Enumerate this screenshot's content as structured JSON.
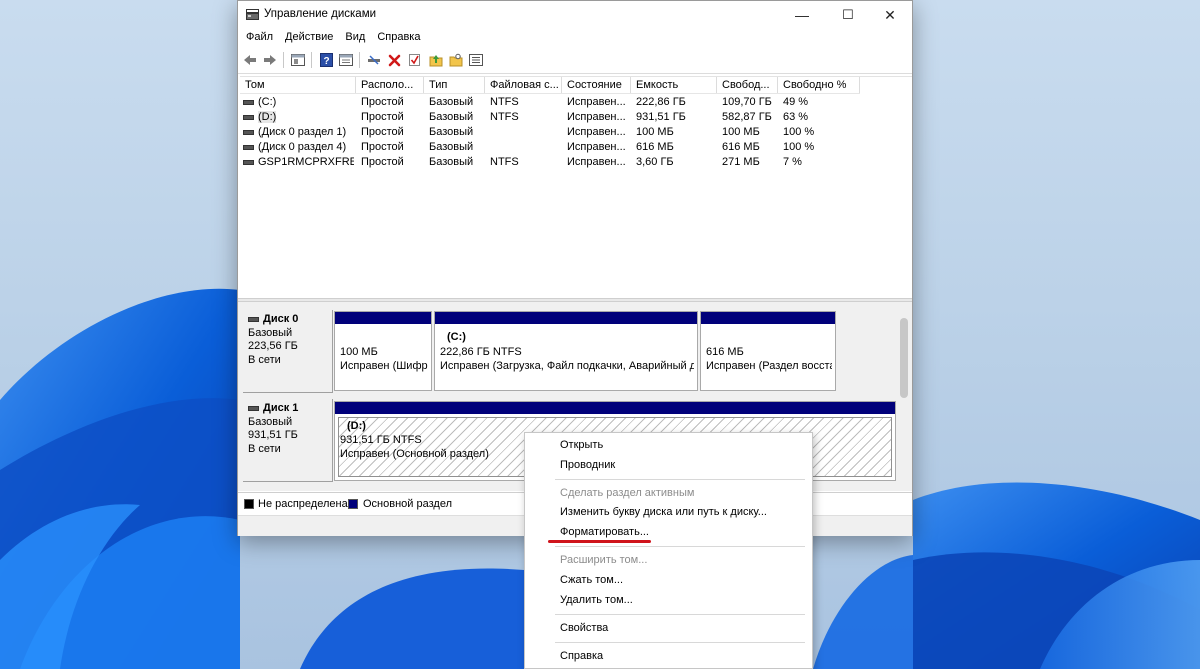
{
  "window": {
    "title": "Управление дисками",
    "minimize_glyph": "—",
    "maximize_glyph": "☐",
    "close_glyph": "✕"
  },
  "menu": [
    "Файл",
    "Действие",
    "Вид",
    "Справка"
  ],
  "toolbar": {
    "icons": [
      "back-icon",
      "forward-icon",
      "properties-pane-icon",
      "help-icon",
      "console-icon",
      "connect-icon",
      "delete-icon",
      "check-icon",
      "folder-up-icon",
      "folder-search-icon",
      "details-icon"
    ]
  },
  "volume_table": {
    "columns": [
      "Том",
      "Располо...",
      "Тип",
      "Файловая с...",
      "Состояние",
      "Емкость",
      "Свобод...",
      "Свободно %"
    ],
    "rows": [
      {
        "name": "(C:)",
        "layout": "Простой",
        "type": "Базовый",
        "fs": "NTFS",
        "status": "Исправен...",
        "capacity": "222,86 ГБ",
        "free": "109,70 ГБ",
        "free_pct": "49 %"
      },
      {
        "name": "(D:)",
        "layout": "Простой",
        "type": "Базовый",
        "fs": "NTFS",
        "status": "Исправен...",
        "capacity": "931,51 ГБ",
        "free": "582,87 ГБ",
        "free_pct": "63 %"
      },
      {
        "name": "(Диск 0 раздел 1)",
        "layout": "Простой",
        "type": "Базовый",
        "fs": "",
        "status": "Исправен...",
        "capacity": "100 МБ",
        "free": "100 МБ",
        "free_pct": "100 %"
      },
      {
        "name": "(Диск 0 раздел 4)",
        "layout": "Простой",
        "type": "Базовый",
        "fs": "",
        "status": "Исправен...",
        "capacity": "616 МБ",
        "free": "616 МБ",
        "free_pct": "100 %"
      },
      {
        "name": "GSP1RMCPRXFRE...",
        "layout": "Простой",
        "type": "Базовый",
        "fs": "NTFS",
        "status": "Исправен...",
        "capacity": "3,60 ГБ",
        "free": "271 МБ",
        "free_pct": "7 %"
      }
    ]
  },
  "disks": [
    {
      "label": "Диск 0",
      "type": "Базовый",
      "size": "223,56 ГБ",
      "state": "В сети",
      "partitions": [
        {
          "title": "",
          "line1": "100 МБ",
          "line2": "Исправен (Шифр"
        },
        {
          "title": "(C:)",
          "line1": "222,86 ГБ NTFS",
          "line2": "Исправен (Загрузка, Файл подкачки, Аварийный д"
        },
        {
          "title": "",
          "line1": "616 МБ",
          "line2": "Исправен (Раздел восста"
        }
      ]
    },
    {
      "label": "Диск 1",
      "type": "Базовый",
      "size": "931,51 ГБ",
      "state": "В сети",
      "partitions": [
        {
          "title": "(D:)",
          "line1": "931,51 ГБ NTFS",
          "line2": "Исправен (Основной раздел)"
        }
      ]
    }
  ],
  "legend": [
    {
      "label": "Не распределена",
      "color": "#000000"
    },
    {
      "label": "Основной раздел",
      "color": "#00007a"
    }
  ],
  "context_menu": {
    "items": [
      {
        "label": "Открыть",
        "disabled": false
      },
      {
        "label": "Проводник",
        "disabled": false
      },
      {
        "label": "Сделать раздел активным",
        "disabled": true
      },
      {
        "label": "Изменить букву диска или путь к диску...",
        "disabled": false
      },
      {
        "label": "Форматировать...",
        "disabled": false
      },
      {
        "label": "Расширить том...",
        "disabled": true
      },
      {
        "label": "Сжать том...",
        "disabled": false
      },
      {
        "label": "Удалить том...",
        "disabled": false
      },
      {
        "label": "Свойства",
        "disabled": false
      },
      {
        "label": "Справка",
        "disabled": false
      }
    ],
    "highlight_color": "#d0141c"
  }
}
